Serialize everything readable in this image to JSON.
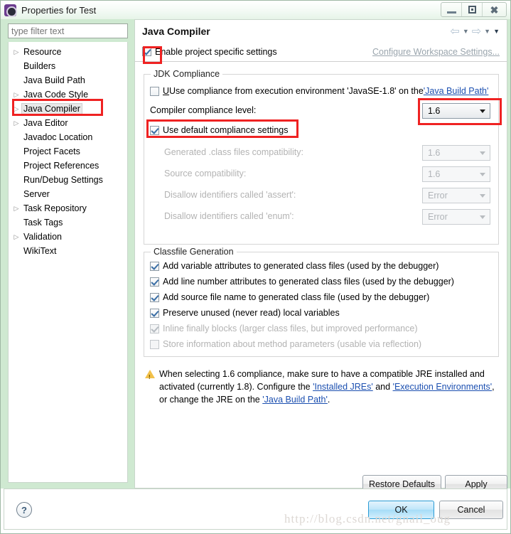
{
  "window": {
    "title": "Properties for Test",
    "icon": "eclipse-properties-icon",
    "minimize_label": "–",
    "maximize_label": "□",
    "close_label": "✕"
  },
  "sidebar": {
    "filter": {
      "value": "",
      "placeholder": "type filter text"
    },
    "items": [
      {
        "label": "Resource",
        "expandable": true,
        "selected": false
      },
      {
        "label": "Builders",
        "expandable": false,
        "selected": false
      },
      {
        "label": "Java Build Path",
        "expandable": false,
        "selected": false
      },
      {
        "label": "Java Code Style",
        "expandable": true,
        "selected": false
      },
      {
        "label": "Java Compiler",
        "expandable": true,
        "selected": true
      },
      {
        "label": "Java Editor",
        "expandable": true,
        "selected": false
      },
      {
        "label": "Javadoc Location",
        "expandable": false,
        "selected": false
      },
      {
        "label": "Project Facets",
        "expandable": false,
        "selected": false
      },
      {
        "label": "Project References",
        "expandable": false,
        "selected": false
      },
      {
        "label": "Run/Debug Settings",
        "expandable": false,
        "selected": false
      },
      {
        "label": "Server",
        "expandable": false,
        "selected": false
      },
      {
        "label": "Task Repository",
        "expandable": true,
        "selected": false
      },
      {
        "label": "Task Tags",
        "expandable": false,
        "selected": false
      },
      {
        "label": "Validation",
        "expandable": true,
        "selected": false
      },
      {
        "label": "WikiText",
        "expandable": false,
        "selected": false
      }
    ]
  },
  "page": {
    "title": "Java Compiler",
    "nav": {
      "back_icon": "arrow-left-icon",
      "back_menu_icon": "chevron-down-icon",
      "forward_icon": "arrow-right-icon",
      "forward_menu_icon": "chevron-down-icon",
      "menu_icon": "chevron-down-icon"
    },
    "enable_specific": {
      "label": "Enable project specific settings",
      "checked": true,
      "workspace_link": "Configure Workspace Settings..."
    },
    "jdk_compliance": {
      "title": "JDK Compliance",
      "use_exec_env": {
        "label_before": "Use compliance from execution environment 'JavaSE-1.8' on the ",
        "link": "'Java Build Path'",
        "checked": false
      },
      "compliance_level": {
        "label": "Compiler compliance level:",
        "value": "1.6"
      },
      "use_default": {
        "label": "Use default compliance settings",
        "checked": true
      },
      "rows": [
        {
          "label": "Generated .class files compatibility:",
          "value": "1.6",
          "disabled": true
        },
        {
          "label": "Source compatibility:",
          "value": "1.6",
          "disabled": true
        },
        {
          "label": "Disallow identifiers called 'assert':",
          "value": "Error",
          "disabled": true
        },
        {
          "label": "Disallow identifiers called 'enum':",
          "value": "Error",
          "disabled": true
        }
      ]
    },
    "classfile_generation": {
      "title": "Classfile Generation",
      "options": [
        {
          "label": "Add variable attributes to generated class files (used by the debugger)",
          "checked": true,
          "disabled": false
        },
        {
          "label": "Add line number attributes to generated class files (used by the debugger)",
          "checked": true,
          "disabled": false
        },
        {
          "label": "Add source file name to generated class file (used by the debugger)",
          "checked": true,
          "disabled": false
        },
        {
          "label": "Preserve unused (never read) local variables",
          "checked": true,
          "disabled": false
        },
        {
          "label": "Inline finally blocks (larger class files, but improved performance)",
          "checked": true,
          "disabled": true
        },
        {
          "label": "Store information about method parameters (usable via reflection)",
          "checked": false,
          "disabled": true
        }
      ]
    },
    "warning": {
      "icon": "warning-triangle-icon",
      "text_1": "When selecting 1.6 compliance, make sure to have a compatible JRE installed and activated (currently 1.8). Configure the ",
      "link_1": "'Installed JREs'",
      "text_2": " and ",
      "link_2": "'Execution Environments'",
      "text_3": ", or change the JRE on the ",
      "link_3": "'Java Build Path'",
      "text_4": "."
    },
    "restore_defaults_label": "Restore Defaults",
    "apply_label": "Apply"
  },
  "footer": {
    "help_icon": "question-mark-icon",
    "ok_label": "OK",
    "cancel_label": "Cancel"
  },
  "watermark": "http://blog.csdn.net/gnail_oug",
  "colors": {
    "frame_green": "#cfe9d1",
    "highlight_red": "#ef2222",
    "link_blue": "#1b4fb0",
    "ok_blue": "#2a9bd4"
  }
}
